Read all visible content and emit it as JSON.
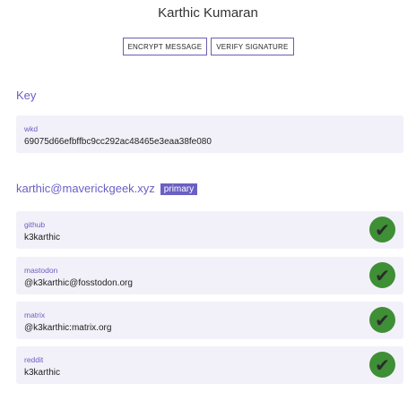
{
  "header": {
    "name": "Karthic Kumaran",
    "encrypt_label": "ENCRYPT MESSAGE",
    "verify_label": "VERIFY SIGNATURE"
  },
  "key_section": {
    "title": "Key",
    "label": "wkd",
    "fingerprint": "69075d66efbffbc9cc292ac48465e3eaa38fe080"
  },
  "identity": {
    "email": "karthic@maverickgeek.xyz",
    "badge": "primary",
    "proofs": [
      {
        "service": "github",
        "handle": "k3karthic",
        "icon": "check-icon"
      },
      {
        "service": "mastodon",
        "handle": "@k3karthic@fosstodon.org",
        "icon": "check-icon"
      },
      {
        "service": "matrix",
        "handle": "@k3karthic:matrix.org",
        "icon": "check-icon"
      },
      {
        "service": "reddit",
        "handle": "k3karthic",
        "icon": "check-icon"
      }
    ]
  },
  "colors": {
    "accent": "#6a5fc4",
    "card_bg": "#f2f1f9",
    "verified_green": "#3e8f35"
  }
}
